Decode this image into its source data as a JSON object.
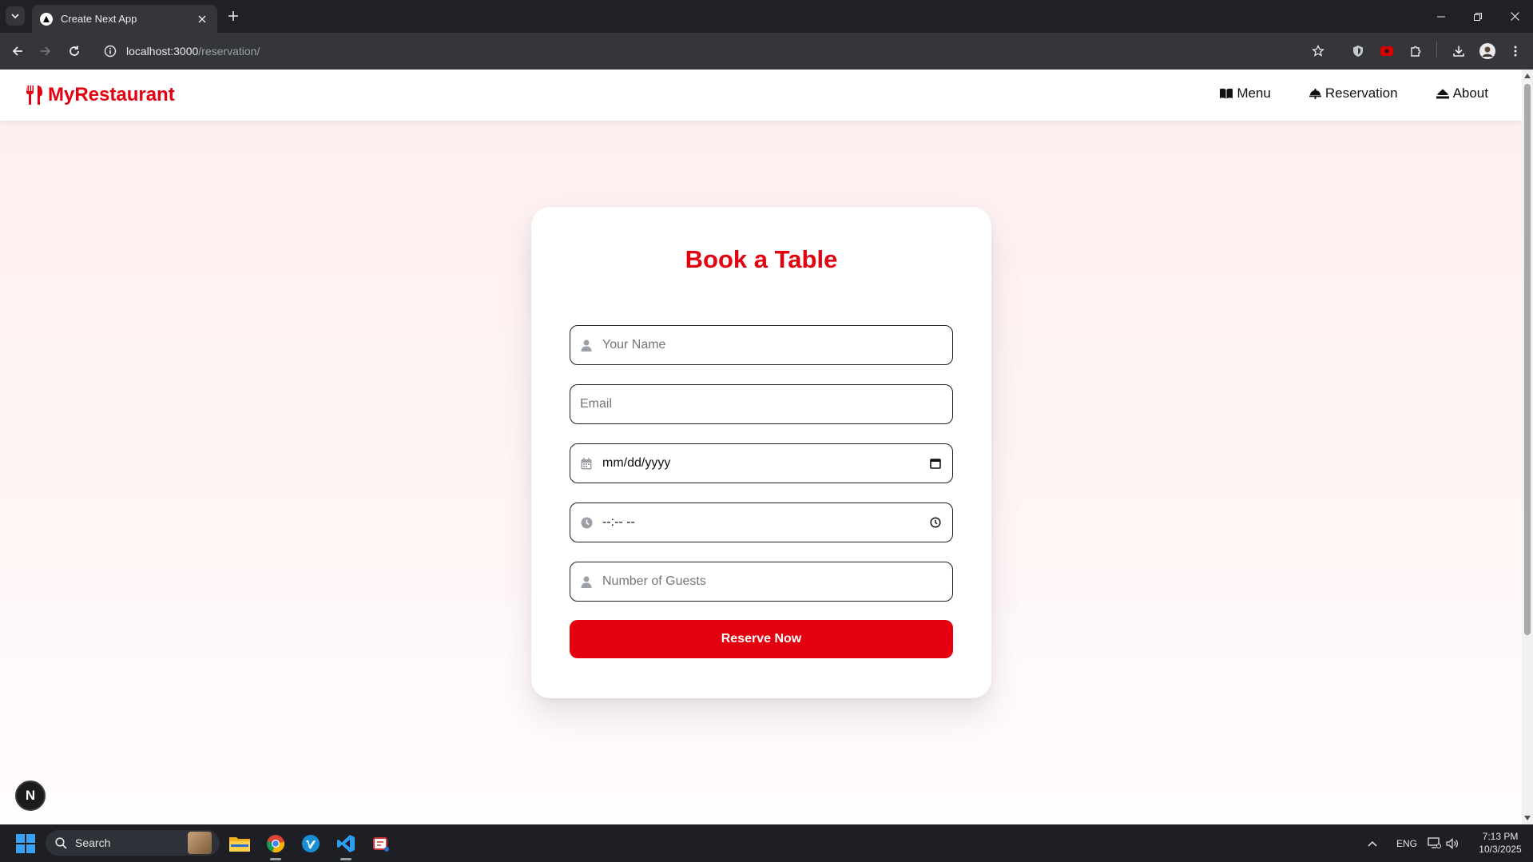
{
  "browser": {
    "tab_title": "Create Next App",
    "url_host": "localhost:3000",
    "url_path": "/reservation/"
  },
  "site": {
    "brand": "MyRestaurant",
    "brand_color": "#e3000f",
    "nav": [
      {
        "label": "Menu",
        "icon": "book-icon"
      },
      {
        "label": "Reservation",
        "icon": "bell-icon"
      },
      {
        "label": "About",
        "icon": "home-icon"
      }
    ]
  },
  "form": {
    "title": "Book a Table",
    "name_placeholder": "Your Name",
    "email_placeholder": "Email",
    "date_value": "mm/dd/yyyy",
    "time_value": "--:-- --",
    "guests_placeholder": "Number of Guests",
    "submit_label": "Reserve Now"
  },
  "dev_badge": "N",
  "taskbar": {
    "search_label": "Search",
    "lang": "ENG",
    "time": "7:13 PM",
    "date": "10/3/2025"
  }
}
